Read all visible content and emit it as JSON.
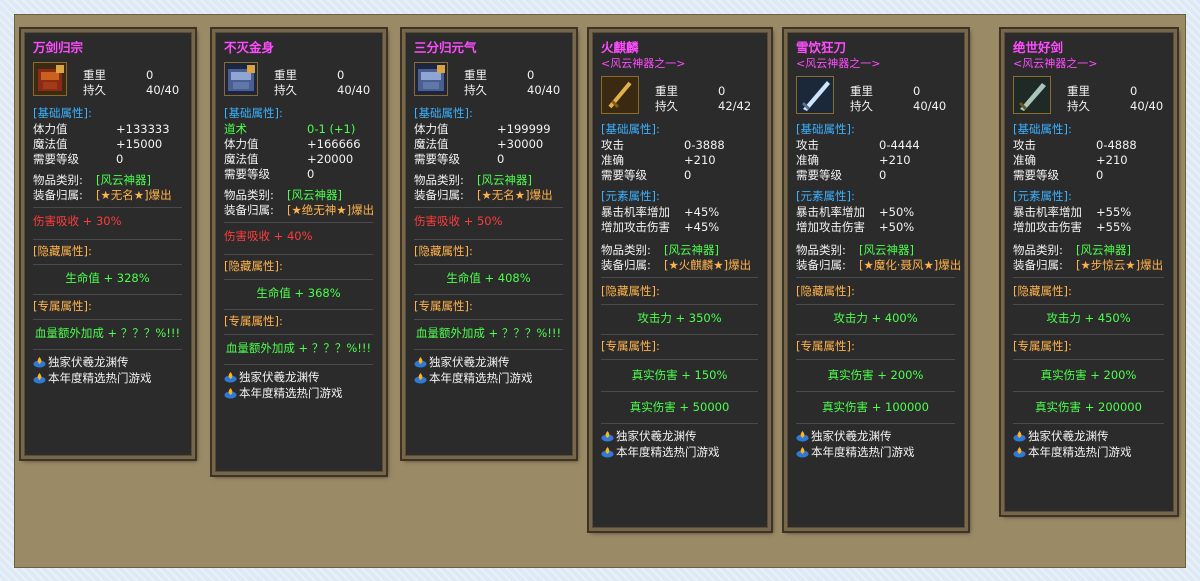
{
  "promo": [
    "独家伏羲龙渊传",
    "本年度精选热门游戏"
  ],
  "labels": {
    "weight": "重里",
    "durability": "持久",
    "base_attr": "[基础属性]:",
    "element_attr": "[元素属性]:",
    "hidden_attr": "[隐藏属性]:",
    "exclusive_attr": "[专属属性]:",
    "item_class": "物品类别:",
    "drop_source": "装备归属:"
  },
  "items": [
    {
      "name": "万剑归宗",
      "weight": "0",
      "durability": "40/40",
      "icon": "armor-red-icon",
      "base": [
        [
          "体力值",
          "+133333"
        ],
        [
          "魔法值",
          "+15000"
        ],
        [
          "需要等级",
          "0"
        ]
      ],
      "class": "[风云神器]",
      "drop": "[★无名★]爆出",
      "absorb": "伤害吸收 + 30%",
      "hidden": [
        "生命值 + 328%"
      ],
      "exclusive": [
        "血量额外加成 + ？？？%!!!"
      ]
    },
    {
      "name": "不灭金身",
      "weight": "0",
      "durability": "40/40",
      "icon": "armor-blue-icon",
      "base_special": [
        "道术",
        "0-1 (+1)"
      ],
      "base": [
        [
          "体力值",
          "+166666"
        ],
        [
          "魔法值",
          "+20000"
        ],
        [
          "需要等级",
          "0"
        ]
      ],
      "class": "[风云神器]",
      "drop": "[★绝无神★]爆出",
      "absorb": "伤害吸收 + 40%",
      "hidden": [
        "生命值 + 368%"
      ],
      "exclusive": [
        "血量额外加成 + ？？？%!!!"
      ]
    },
    {
      "name": "三分归元气",
      "weight": "0",
      "durability": "40/40",
      "icon": "armor-blue-icon",
      "base": [
        [
          "体力值",
          "+199999"
        ],
        [
          "魔法值",
          "+30000"
        ],
        [
          "需要等级",
          "0"
        ]
      ],
      "class": "[风云神器]",
      "drop": "[★无名★]爆出",
      "absorb": "伤害吸收 + 50%",
      "hidden": [
        "生命值 + 408%"
      ],
      "exclusive": [
        "血量额外加成 + ？？？%!!!"
      ]
    },
    {
      "name": "火麒麟",
      "subtitle": "<风云神器之一>",
      "weight": "0",
      "durability": "42/42",
      "icon": "sword-gold-icon",
      "base": [
        [
          "攻击",
          "0-3888"
        ],
        [
          "准确",
          "+210"
        ],
        [
          "需要等级",
          "0"
        ]
      ],
      "element": [
        [
          "暴击机率增加",
          "+45%"
        ],
        [
          "增加攻击伤害",
          "+45%"
        ]
      ],
      "class": "[风云神器]",
      "drop": "[★火麒麟★]爆出",
      "hidden": [
        "攻击力 + 350%"
      ],
      "exclusive": [
        "真实伤害 + 150%",
        "真实伤害 + 50000"
      ]
    },
    {
      "name": "雪饮狂刀",
      "subtitle": "<风云神器之一>",
      "weight": "0",
      "durability": "40/40",
      "icon": "blade-ice-icon",
      "base": [
        [
          "攻击",
          "0-4444"
        ],
        [
          "准确",
          "+210"
        ],
        [
          "需要等级",
          "0"
        ]
      ],
      "element": [
        [
          "暴击机率增加",
          "+50%"
        ],
        [
          "增加攻击伤害",
          "+50%"
        ]
      ],
      "class": "[风云神器]",
      "drop": "[★魔化·聂风★]爆出",
      "hidden": [
        "攻击力 + 400%"
      ],
      "exclusive": [
        "真实伤害 + 200%",
        "真实伤害 + 100000"
      ]
    },
    {
      "name": "绝世好剑",
      "subtitle": "<风云神器之一>",
      "weight": "0",
      "durability": "40/40",
      "icon": "sword-green-icon",
      "base": [
        [
          "攻击",
          "0-4888"
        ],
        [
          "准确",
          "+210"
        ],
        [
          "需要等级",
          "0"
        ]
      ],
      "element": [
        [
          "暴击机率增加",
          "+55%"
        ],
        [
          "增加攻击伤害",
          "+55%"
        ]
      ],
      "class": "[风云神器]",
      "drop": "[★步惊云★]爆出",
      "hidden": [
        "攻击力 + 450%"
      ],
      "exclusive": [
        "真实伤害 + 200%",
        "真实伤害 + 200000"
      ]
    }
  ]
}
